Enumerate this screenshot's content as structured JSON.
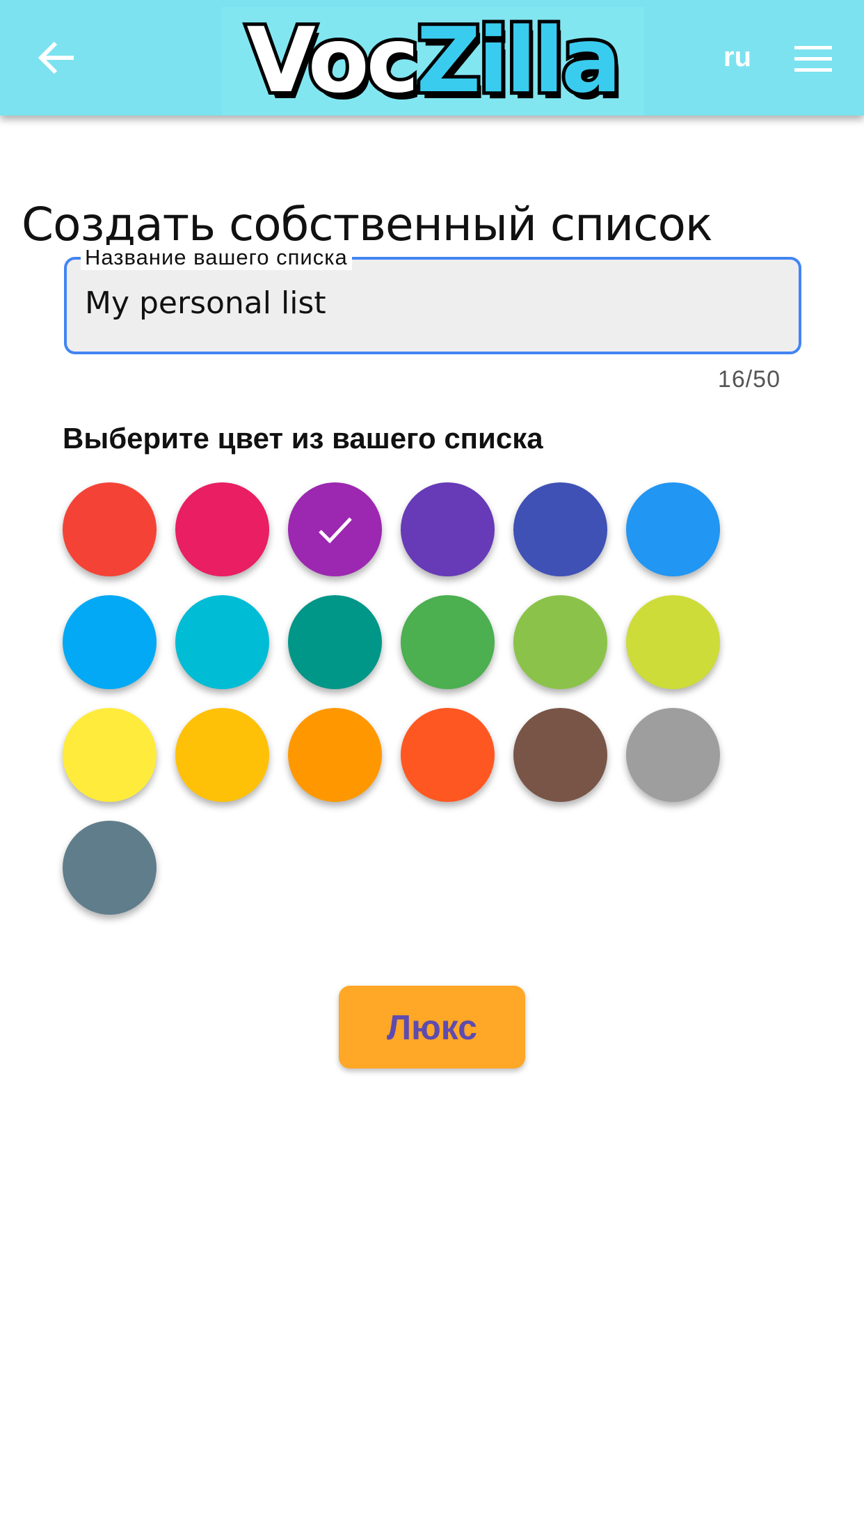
{
  "header": {
    "logo_part1": "Voc",
    "logo_part2": "Zilla",
    "language": "ru",
    "back_icon": "arrow-left-icon",
    "menu_icon": "hamburger-menu-icon"
  },
  "page_title": "Создать собственный список",
  "name_field": {
    "label": "Название вашего списка",
    "value": "My personal list",
    "counter": "16/50"
  },
  "color_section": {
    "title": "Выберите цвет из вашего списка",
    "selected_index": 2,
    "colors": [
      "#F44336",
      "#E91E63",
      "#9C27B0",
      "#673AB7",
      "#3F51B5",
      "#2196F3",
      "#03A9F4",
      "#00BCD4",
      "#009688",
      "#4CAF50",
      "#8BC34A",
      "#CDDC39",
      "#FFEB3B",
      "#FFC107",
      "#FF9800",
      "#FF5722",
      "#795548",
      "#9E9E9E",
      "#607D8B"
    ]
  },
  "lux_button": "Люкс"
}
